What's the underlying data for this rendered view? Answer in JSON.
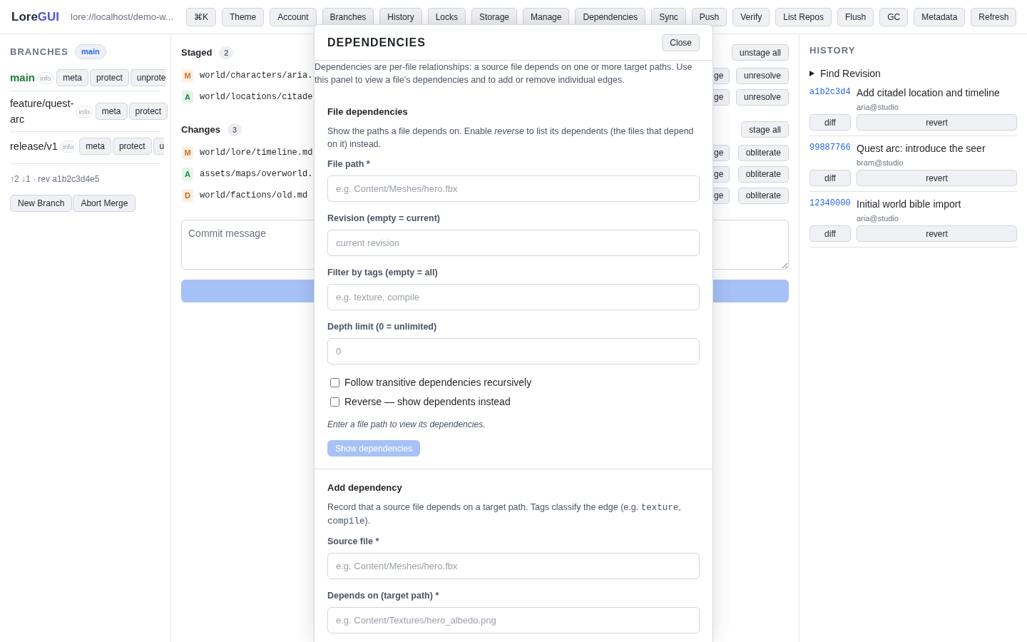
{
  "top_bar": {
    "logo": {
      "text": "Lore",
      "accent": "GUI"
    },
    "address": "lore://localhost/demo-w...",
    "buttons": [
      "⌘K",
      "Theme",
      "Account",
      "Branches",
      "History",
      "Locks",
      "Storage",
      "Manage",
      "Dependencies",
      "Sync",
      "Push",
      "Verify",
      "List Repos",
      "Flush",
      "GC",
      "Metadata",
      "Refresh"
    ]
  },
  "branches_panel": {
    "title": "BRANCHES",
    "current_branch": "main",
    "branches": [
      {
        "name": "main",
        "current": true,
        "info": "info",
        "buttons": [
          "meta",
          "protect",
          "unprote"
        ]
      },
      {
        "name": "feature/quest-arc",
        "current": false,
        "info": "info",
        "buttons": [
          "meta",
          "protect"
        ]
      },
      {
        "name": "release/v1",
        "current": false,
        "info": "info",
        "buttons": [
          "meta",
          "protect",
          "u"
        ]
      }
    ],
    "status": "↑2 ↓1 · rev a1b2c3d4e5",
    "buttons": [
      "New Branch",
      "Abort Merge"
    ]
  },
  "changes_panel": {
    "groups": [
      {
        "title": "Staged",
        "count": "2",
        "action": "unstage all",
        "files": [
          {
            "kind": "modified",
            "status": "M",
            "path": "world/characters/aria.",
            "actions": [
              "ge",
              "unresolve"
            ]
          },
          {
            "kind": "added",
            "status": "A",
            "path": "world/locations/citade",
            "actions": [
              "ge",
              "unresolve"
            ]
          }
        ]
      },
      {
        "title": "Changes",
        "count": "3",
        "action": "stage all",
        "files": [
          {
            "kind": "modified",
            "status": "M",
            "path": "world/lore/timeline.md",
            "actions": [
              "ge",
              "obliterate"
            ]
          },
          {
            "kind": "added",
            "status": "A",
            "path": "assets/maps/overworld.",
            "actions": [
              "ge",
              "obliterate"
            ]
          },
          {
            "kind": "deleted",
            "status": "D",
            "path": "world/factions/old.md",
            "actions": [
              "ge",
              "obliterate"
            ]
          }
        ]
      }
    ],
    "commit_message": {
      "placeholder": "Commit message"
    },
    "commit_button": {
      "disabled": true
    }
  },
  "history_panel": {
    "title": "HISTORY",
    "find_revision": {
      "label": "Find Revision",
      "expanded": false
    },
    "commits": [
      {
        "hash": "a1b2c3d4",
        "message": "Add citadel location and timeline",
        "author": "aria@studio",
        "buttons": [
          "diff",
          "revert"
        ]
      },
      {
        "hash": "99887766",
        "message": "Quest arc: introduce the seer",
        "author": "bram@studio",
        "buttons": [
          "diff",
          "revert"
        ]
      },
      {
        "hash": "12340000",
        "message": "Initial world bible import",
        "author": "aria@studio",
        "buttons": [
          "diff",
          "revert"
        ]
      }
    ]
  },
  "dependencies_dialog": {
    "title": "DEPENDENCIES",
    "close": "Close",
    "intro": "Dependencies are per-file relationships: a source file depends on one or more target paths. Use this panel to view a file's dependencies and to add or remove individual edges.",
    "sections": [
      {
        "title": "File dependencies",
        "description": [
          {
            "kind": "text",
            "text": "Show the paths a file depends on. Enable *reverse* to list its dependents (the files that depend on it) instead."
          }
        ],
        "fields": [
          {
            "label": "File path *",
            "placeholder": "e.g. Content/Meshes/hero.fbx"
          },
          {
            "label": "Revision (empty = current)",
            "placeholder": "current revision"
          },
          {
            "label": "Filter by tags (empty = all)",
            "placeholder": "e.g. texture, compile"
          },
          {
            "label": "Depth limit (0 = unlimited)",
            "placeholder": "0"
          }
        ],
        "options": [
          {
            "label": "Follow transitive dependencies recursively",
            "checked": false
          },
          {
            "label": "Reverse — show dependents instead",
            "checked": false
          }
        ],
        "hint": "Enter a file path to view its dependencies.",
        "button": {
          "label": "Show dependencies",
          "disabled": true
        }
      },
      {
        "title": "Add dependency",
        "description": [
          {
            "kind": "text",
            "text": "Record that a source file depends on a target path. Tags classify the edge (e.g. "
          },
          {
            "kind": "code",
            "text": "texture"
          },
          {
            "kind": "text",
            "text": ", "
          },
          {
            "kind": "code",
            "text": "compile"
          },
          {
            "kind": "text",
            "text": ")."
          }
        ],
        "fields": [
          {
            "label": "Source file *",
            "placeholder": "e.g. Content/Meshes/hero.fbx"
          },
          {
            "label": "Depends on (target path) *",
            "placeholder": "e.g. Content/Textures/hero_albedo.png"
          }
        ]
      }
    ]
  }
}
